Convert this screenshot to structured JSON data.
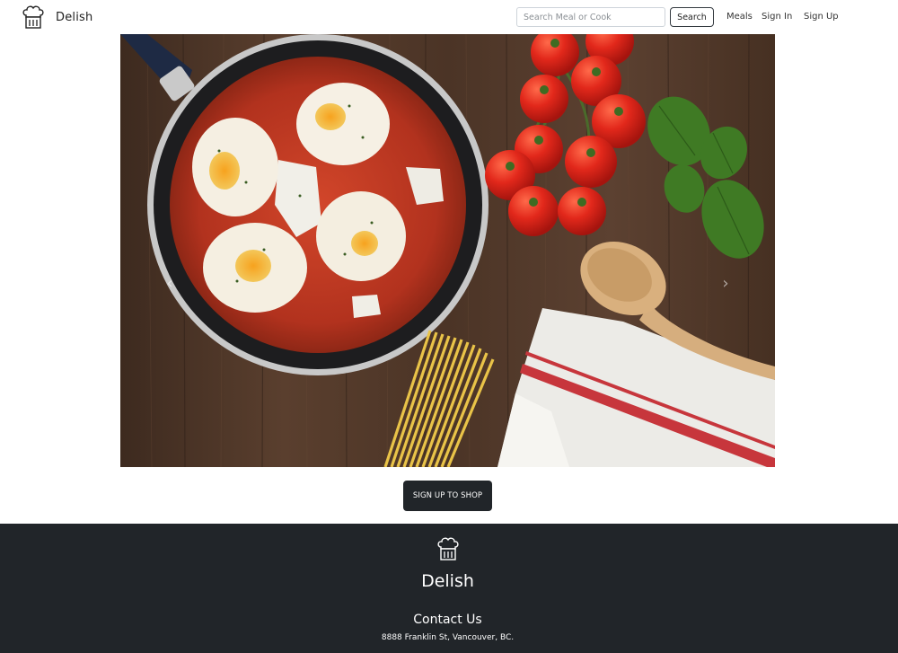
{
  "navbar": {
    "brand_name": "Delish",
    "logo_icon": "chef-hat-icon",
    "search": {
      "placeholder": "Search Meal or Cook",
      "value": ""
    },
    "search_button_label": "Search",
    "links": {
      "meals": "Meals",
      "sign_in": "Sign In",
      "sign_up": "Sign Up"
    }
  },
  "hero": {
    "image": "shakshuka-pan-tomatoes-basil-spaghetti-spoon-towel-photo",
    "prev_icon": "chevron-left-icon",
    "next_icon": "chevron-right-icon",
    "prev_glyph": "‹",
    "next_glyph": "›"
  },
  "cta": {
    "label": "SIGN UP TO SHOP"
  },
  "footer": {
    "logo_icon": "chef-hat-icon",
    "brand_name": "Delish",
    "contact_title": "Contact Us",
    "address": "8888 Franklin St, Vancouver, BC."
  },
  "colors": {
    "footer_bg": "#212529",
    "button_dark": "#212529",
    "background": "#ffffff"
  }
}
